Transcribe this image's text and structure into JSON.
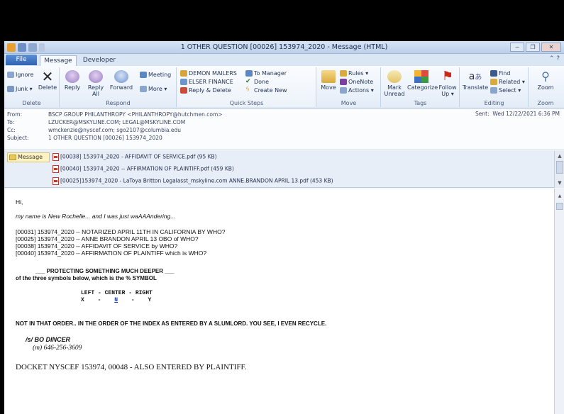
{
  "window": {
    "title": "1 OTHER QUESTION  [00026] 153974_2020 - Message (HTML)",
    "controls": [
      "−",
      "❐",
      "✕"
    ]
  },
  "tabs": {
    "file": "File",
    "items": [
      "Message",
      "Developer"
    ]
  },
  "ribbon": {
    "delete_group": {
      "ignore": "Ignore",
      "junk": "Junk ▾",
      "delete": "Delete",
      "label": "Delete"
    },
    "respond_group": {
      "reply": "Reply",
      "reply_all": "Reply All",
      "forward": "Forward",
      "meeting": "Meeting",
      "more": "More ▾",
      "label": "Respond"
    },
    "quick_steps": {
      "items": [
        "DEMON MAILERS",
        "ELSER FINANCE",
        "Reply & Delete",
        "To Manager",
        "Done",
        "Create New"
      ],
      "label": "Quick Steps"
    },
    "move_group": {
      "move": "Move",
      "rules": "Rules ▾",
      "onenote": "OneNote",
      "actions": "Actions ▾",
      "label": "Move"
    },
    "tags_group": {
      "mark_unread": "Mark Unread",
      "categorize": "Categorize",
      "follow_up": "Follow Up ▾",
      "label": "Tags"
    },
    "editing_group": {
      "translate": "Translate",
      "find": "Find",
      "related": "Related ▾",
      "select": "Select ▾",
      "label": "Editing"
    },
    "zoom_group": {
      "zoom": "Zoom",
      "label": "Zoom"
    }
  },
  "headers": {
    "from_label": "From:",
    "from": "BSCP GROUP PHILANTHROPY <PHILANTHROPY@hutchmen.com>",
    "to_label": "To:",
    "to": "LZUCKER@MSKYLINE.COM; LEGAL@MSKYLINE.COM",
    "cc_label": "Cc:",
    "cc": "wmckenzie@nyscef.com; sgo2107@columbia.edu",
    "subject_label": "Subject:",
    "subject": "1 OTHER QUESTION  [00026] 153974_2020",
    "sent_label": "Sent:",
    "sent": "Wed 12/22/2021 6:36 PM"
  },
  "attachments": {
    "message_tab": "Message",
    "items": [
      "[00038] 153974_2020 - AFFIDAVIT OF SERVICE.pdf (95 KB)",
      "[00040] 153974_2020 -- AFFIRMATION OF PLAINTIFF.pdf (459 KB)",
      "[00025]153974_2020 - LaToya Britton Legalasst_mskyline.com ANNE.BRANDON APRIL 13.pdf (453 KB)"
    ]
  },
  "body": {
    "greeting": "Hi,",
    "intro": "my name is New Rochelle... and I was just waAAAndering...",
    "lines": [
      "[00031] 153974_2020  -- NOTARIZED APRIL 11TH IN CALIFORNIA BY WHO?",
      "[00025] 153974_2020  -- ANNE BRANDON APRIL 13 OBO of WHO?",
      "[00038] 153974_2020  -- AFFIDAVIT OF SERVICE by WHO?",
      "[00040] 153974_2020  -- AFFIRMATION OF PLAINTIFF which is WHO?"
    ],
    "protecting": "___  PROTECTING SOMETHING MUCH DEEPER  ___",
    "three_symbols": "of the three symbols below, which is the % SYMBOL",
    "lcr_header": "LEFT  -  CENTER  -  RIGHT",
    "lcr_left": "X",
    "lcr_sep1": "-",
    "lcr_center": "N",
    "lcr_sep2": "-",
    "lcr_right": "Y",
    "not_in_order": "NOT IN THAT ORDER.. IN THE ORDER OF THE INDEX AS ENTERED BY A SLUMLORD. YOU SEE, I EVEN RECYCLE.",
    "sig_name": "/s/ BO DINCER",
    "sig_phone": "(m) 646-256-3609",
    "docket": "DOCKET NYSCEF 153974, 00048 - ALSO ENTERED BY PLAINTIFF."
  },
  "colors": {
    "accent": "#2e63b3",
    "link": "#1a3fa8"
  }
}
